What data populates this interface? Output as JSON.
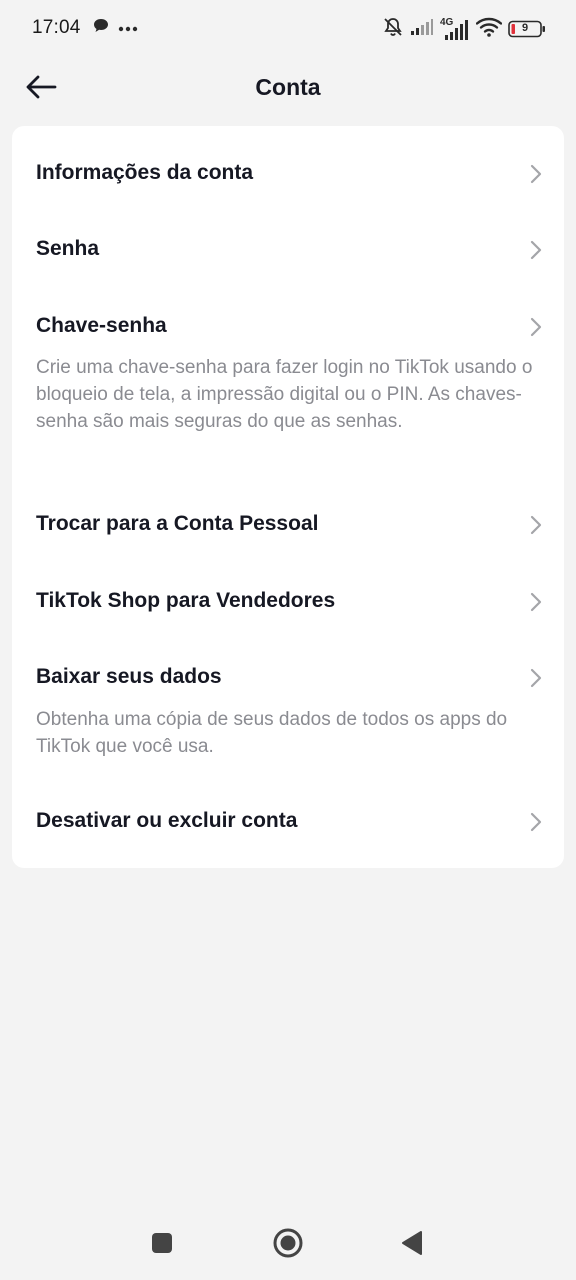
{
  "status_bar": {
    "time": "17:04",
    "network_label": "4G",
    "battery_level": "9",
    "icons": [
      "chat-bubble-icon",
      "more-dots-icon",
      "bell-muted-icon",
      "signal-icon",
      "signal-4g-icon",
      "wifi-icon",
      "battery-icon"
    ]
  },
  "header": {
    "title": "Conta",
    "back_icon": "arrow-left-icon"
  },
  "menu": {
    "items": [
      {
        "label": "Informações da conta",
        "description": ""
      },
      {
        "label": "Senha",
        "description": ""
      },
      {
        "label": "Chave-senha",
        "description": "Crie uma chave-senha para fazer login no TikTok usando o bloqueio de tela, a impressão digital ou o PIN. As chaves-senha são mais seguras do que as senhas."
      },
      {
        "label": "Trocar para a Conta Pessoal",
        "description": ""
      },
      {
        "label": "TikTok Shop para Vendedores",
        "description": ""
      },
      {
        "label": "Baixar seus dados",
        "description": "Obtenha uma cópia de seus dados de todos os apps do TikTok que você usa."
      },
      {
        "label": "Desativar ou excluir conta",
        "description": ""
      }
    ]
  },
  "nav_bar": {
    "icons": [
      "recent-apps-square-icon",
      "home-circle-icon",
      "back-triangle-icon"
    ]
  },
  "colors": {
    "background": "#f3f3f3",
    "card": "#ffffff",
    "text_primary": "#161823",
    "text_secondary": "#8a8b91",
    "chevron": "#a4a5a9",
    "battery_low": "#e0303a"
  }
}
